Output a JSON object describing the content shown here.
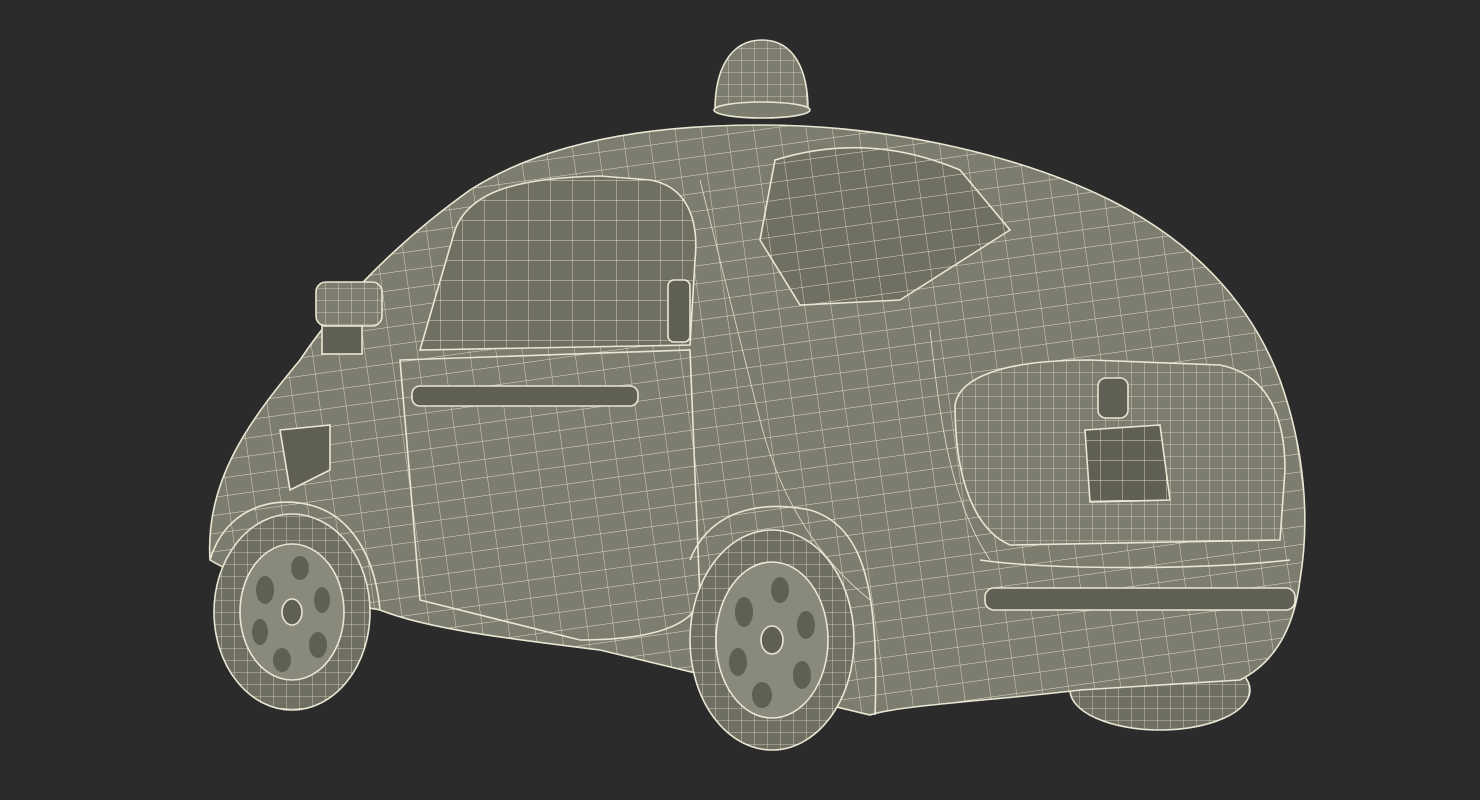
{
  "scene": {
    "subject": "wireframe-self-driving-car",
    "colors": {
      "background": "#2b2b2b",
      "surface": "#7d7d6f",
      "wire": "#e9e6d3",
      "shadow": "#5f5f54"
    }
  }
}
